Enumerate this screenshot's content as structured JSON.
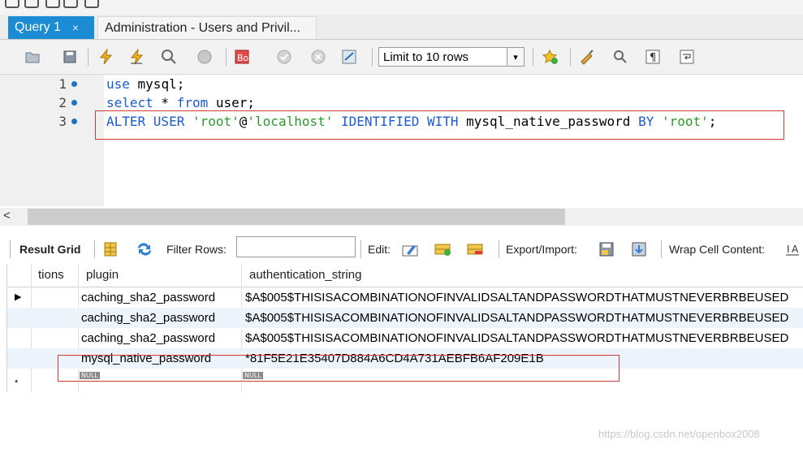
{
  "tabs": [
    {
      "label": "Query 1",
      "close": "×"
    },
    {
      "label": "Administration - Users and Privil..."
    }
  ],
  "toolbar": {
    "limit_label": "Limit to 10 rows",
    "limit_dropdown": "▾"
  },
  "editor": {
    "lines": [
      {
        "num": "1",
        "parts": [
          "use",
          " mysql;"
        ]
      },
      {
        "num": "2",
        "parts": [
          "select",
          " * ",
          "from",
          " user;"
        ]
      },
      {
        "num": "3",
        "parts": [
          "ALTER USER",
          " ",
          "'root'",
          "@",
          "'localhost'",
          " ",
          "IDENTIFIED WITH",
          " mysql_native_password ",
          "BY",
          " ",
          "'root'",
          ";"
        ]
      }
    ]
  },
  "scroll": {
    "left_arrow": "<"
  },
  "results_toolbar": {
    "result_grid": "Result Grid",
    "filter_rows": "Filter Rows:",
    "edit": "Edit:",
    "export_import": "Export/Import:",
    "wrap_cell": "Wrap Cell Content:"
  },
  "grid": {
    "columns": [
      "tions",
      "plugin",
      "authentication_string"
    ],
    "rows": [
      {
        "plugin": "caching_sha2_password",
        "auth": "$A$005$THISISACOMBINATIONOFINVALIDSALTANDPASSWORDTHATMUSTNEVERBRBEUSED",
        "indicator": "▶"
      },
      {
        "plugin": "caching_sha2_password",
        "auth": "$A$005$THISISACOMBINATIONOFINVALIDSALTANDPASSWORDTHATMUSTNEVERBRBEUSED",
        "indicator": ""
      },
      {
        "plugin": "caching_sha2_password",
        "auth": "$A$005$THISISACOMBINATIONOFINVALIDSALTANDPASSWORDTHATMUSTNEVERBRBEUSED",
        "indicator": ""
      },
      {
        "plugin": "mysql_native_password",
        "auth": "*81F5E21E35407D884A6CD4A731AEBFB6AF209E1B",
        "indicator": ""
      }
    ],
    "new_row_indicator": "*",
    "null_label": "NULL"
  },
  "watermark": "https://blog.csdn.net/openbox2008",
  "colors": {
    "tab_active": "#1b8bd3",
    "keyword": "#1a5bd1",
    "string": "#2a9a2a",
    "highlight_box": "#d23a3a",
    "alt_row": "#eef4fb"
  }
}
